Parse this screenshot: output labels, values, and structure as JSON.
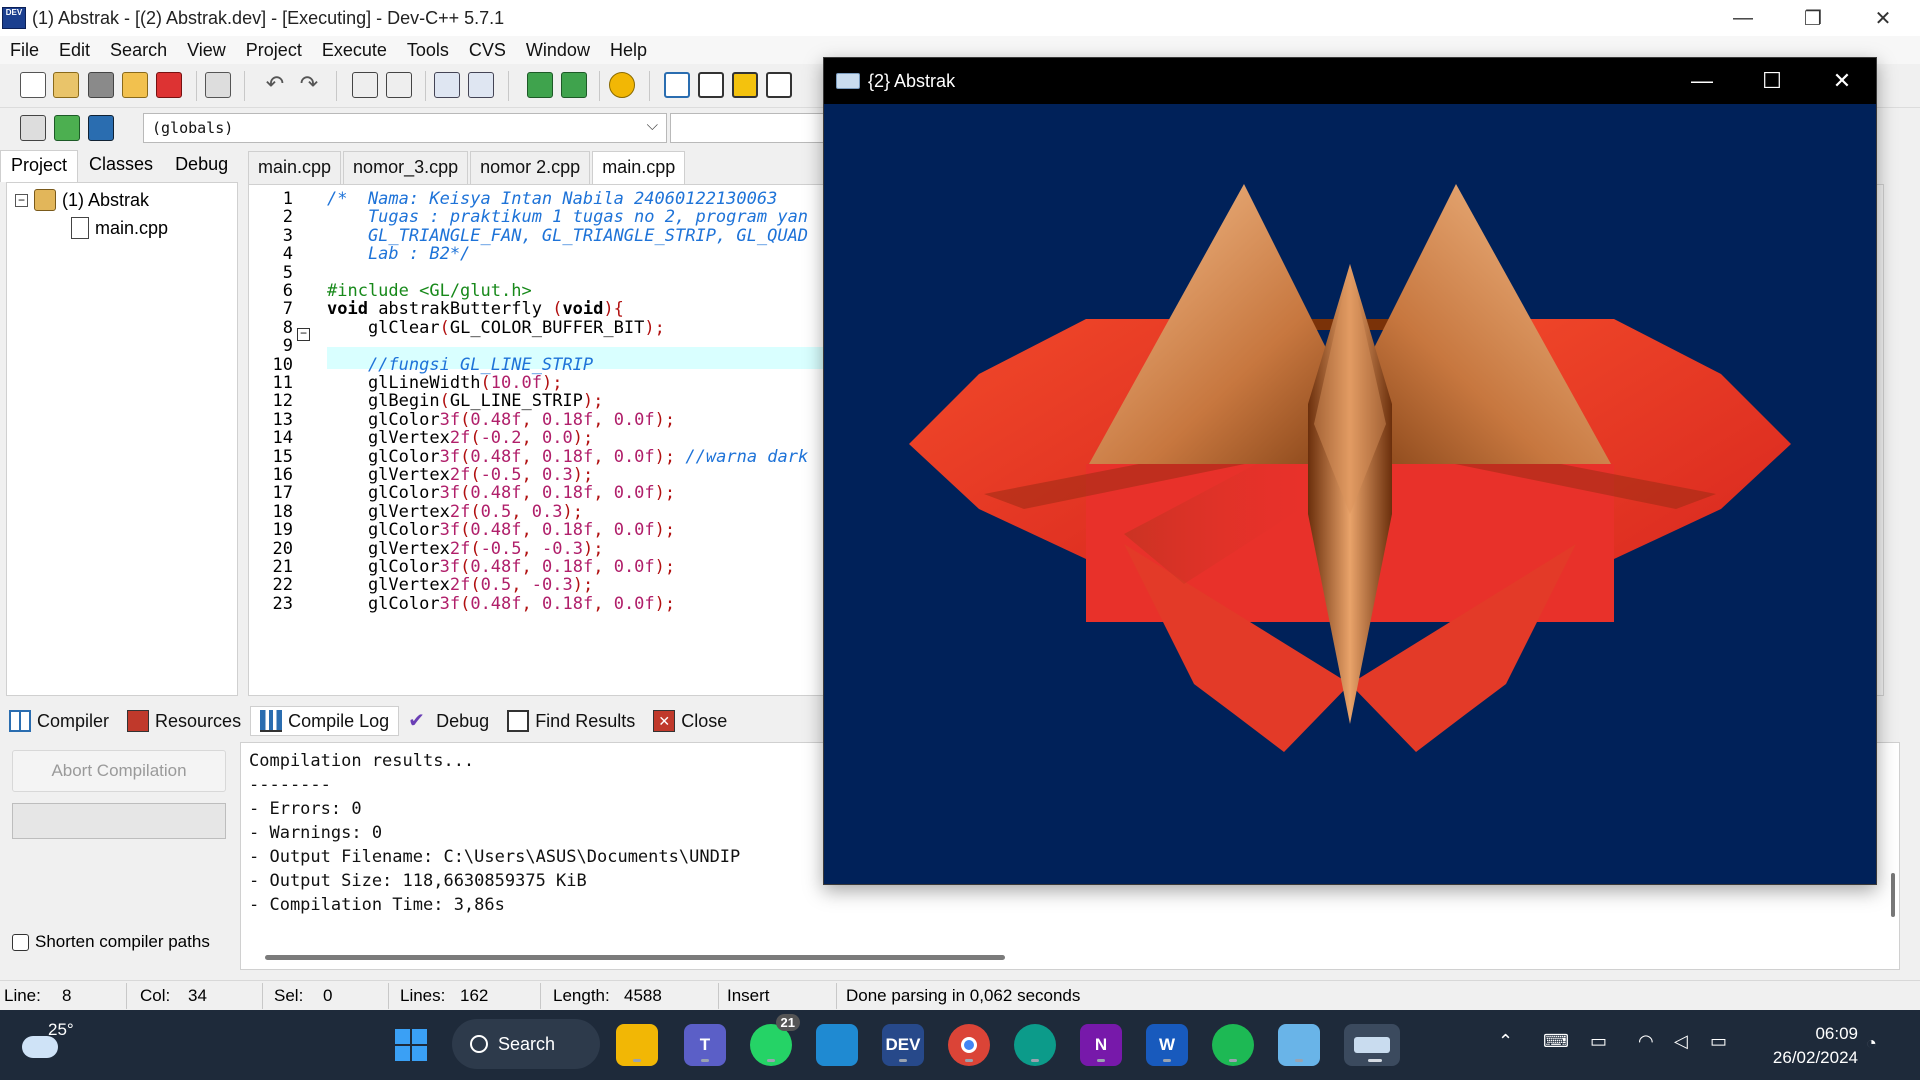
{
  "window": {
    "title": "(1) Abstrak - [(2) Abstrak.dev] - [Executing] - Dev-C++ 5.7.1",
    "minimize": "—",
    "restore": "❐",
    "close": "✕"
  },
  "menu": [
    "File",
    "Edit",
    "Search",
    "View",
    "Project",
    "Execute",
    "Tools",
    "CVS",
    "Window",
    "Help"
  ],
  "scope_combo": "(globals)",
  "left_tabs": [
    "Project",
    "Classes",
    "Debug"
  ],
  "project_tree": {
    "root": "(1) Abstrak",
    "child": "main.cpp"
  },
  "editor_tabs": [
    "main.cpp",
    "nomor_3.cpp",
    "nomor 2.cpp",
    "main.cpp"
  ],
  "code_lines": [
    "/*  Nama: Keisya Intan Nabila 24060122130063",
    "    Tugas : praktikum 1 tugas no 2, program yan",
    "    GL_TRIANGLE_FAN, GL_TRIANGLE_STRIP, GL_QUAD",
    "    Lab : B2*/",
    "",
    "#include <GL/glut.h>",
    "void abstrakButterfly (void){",
    "    glClear(GL_COLOR_BUFFER_BIT);",
    "",
    "    //fungsi GL_LINE_STRIP",
    "    glLineWidth(10.0f);",
    "    glBegin(GL_LINE_STRIP);",
    "    glColor3f(0.48f, 0.18f, 0.0f);",
    "    glVertex2f(-0.2, 0.0);",
    "    glColor3f(0.48f, 0.18f, 0.0f); //warna dark",
    "    glVertex2f(-0.5, 0.3);",
    "    glColor3f(0.48f, 0.18f, 0.0f);",
    "    glVertex2f(0.5, 0.3);",
    "    glColor3f(0.48f, 0.18f, 0.0f);",
    "    glVertex2f(-0.5, -0.3);",
    "    glColor3f(0.48f, 0.18f, 0.0f);",
    "    glVertex2f(0.5, -0.3);",
    "    glColor3f(0.48f, 0.18f, 0.0f);"
  ],
  "bottom_tabs": [
    "Compiler",
    "Resources",
    "Compile Log",
    "Debug",
    "Find Results",
    "Close"
  ],
  "abort_button": "Abort Compilation",
  "shorten_paths": "Shorten compiler paths",
  "log_lines": [
    "Compilation results...",
    "--------",
    "- Errors: 0",
    "- Warnings: 0",
    "- Output Filename: C:\\Users\\ASUS\\Documents\\UNDIP",
    "- Output Size: 118,6630859375 KiB",
    "- Compilation Time: 3,86s"
  ],
  "status": {
    "line_label": "Line:",
    "line": "8",
    "col_label": "Col:",
    "col": "34",
    "sel_label": "Sel:",
    "sel": "0",
    "lines_label": "Lines:",
    "lines": "162",
    "length_label": "Length:",
    "length": "4588",
    "mode": "Insert",
    "message": "Done parsing in 0,062 seconds"
  },
  "gl_window": {
    "title": "{2} Abstrak"
  },
  "taskbar": {
    "temperature": "25°",
    "search": "Search",
    "whatsapp_badge": "21",
    "time": "06:09",
    "date": "26/02/2024"
  },
  "colors": {
    "gl_background": "#002159",
    "wing_red": "#e8312a",
    "cone_light": "#f0b27e",
    "cone_dark": "#7a3a10",
    "taskbar": "#1e2a3a",
    "comment": "#1e73d8",
    "preprocessor": "#17891a",
    "number": "#b01f6a",
    "current_line": "#d9ffff"
  }
}
